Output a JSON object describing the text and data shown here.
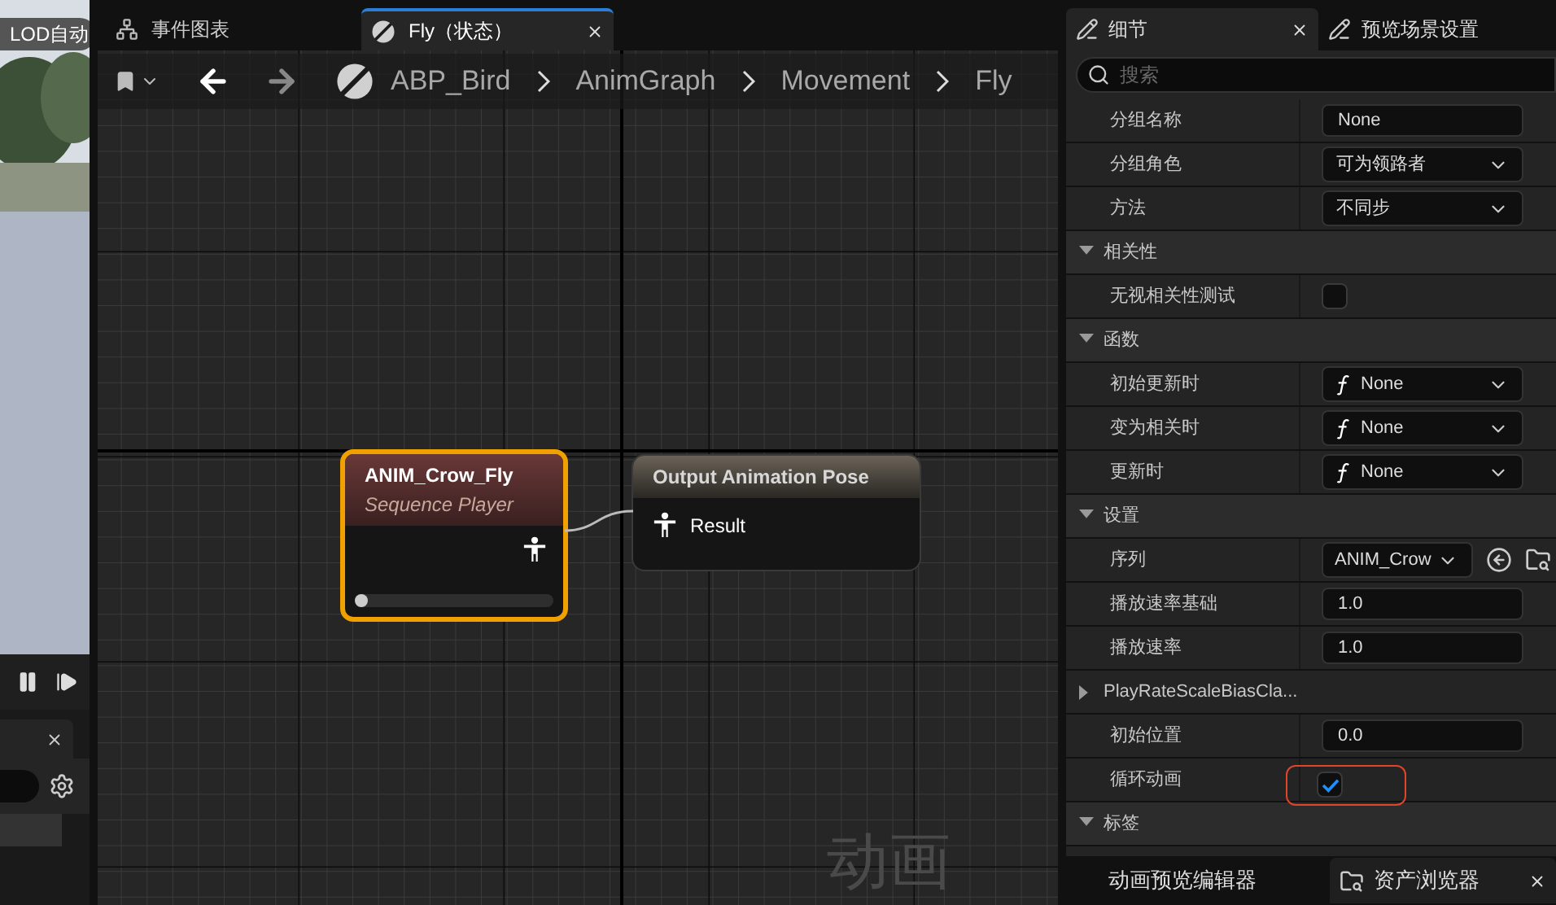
{
  "viewport": {
    "lod_badge": "LOD自动",
    "controls": [
      {
        "kind": "pause"
      },
      {
        "kind": "step"
      }
    ]
  },
  "graph_tabs": [
    {
      "label": "事件图表",
      "selected": false,
      "closable": false
    },
    {
      "label": "Fly（状态）",
      "selected": true,
      "closable": true
    }
  ],
  "breadcrumb": [
    "ABP_Bird",
    "AnimGraph",
    "Movement",
    "Fly"
  ],
  "nodes": [
    {
      "kind": "sequence",
      "title": "ANIM_Crow_Fly",
      "subtitle": "Sequence Player",
      "selected": true,
      "level": 0
    },
    {
      "kind": "output",
      "title": "Output Animation Pose",
      "pin": "Result",
      "selected": false
    }
  ],
  "graph_watermark": "动画",
  "details_tabs": [
    {
      "label": "细节",
      "selected": true,
      "closable": true
    },
    {
      "label": "预览场景设置",
      "selected": false,
      "closable": false
    }
  ],
  "search": {
    "placeholder": "搜索"
  },
  "rows": [
    {
      "kind": "text",
      "label": "分组名称",
      "value": "None"
    },
    {
      "kind": "dropdown",
      "label": "分组角色",
      "value": "可为领路者"
    },
    {
      "kind": "dropdown",
      "label": "方法",
      "value": "不同步"
    },
    {
      "kind": "section",
      "label": "相关性",
      "expanded": true
    },
    {
      "kind": "checkbox",
      "label": "无视相关性测试",
      "checked": false,
      "highlighted": false
    },
    {
      "kind": "section",
      "label": "函数",
      "expanded": true
    },
    {
      "kind": "function",
      "label": "初始更新时",
      "value": "None"
    },
    {
      "kind": "function",
      "label": "变为相关时",
      "value": "None"
    },
    {
      "kind": "function",
      "label": "更新时",
      "value": "None"
    },
    {
      "kind": "section",
      "label": "设置",
      "expanded": true
    },
    {
      "kind": "asset",
      "label": "序列",
      "value": "ANIM_Crow"
    },
    {
      "kind": "text",
      "label": "播放速率基础",
      "value": "1.0"
    },
    {
      "kind": "text",
      "label": "播放速率",
      "value": "1.0"
    },
    {
      "kind": "group",
      "label": "PlayRateScaleBiasCla...",
      "expanded": false
    },
    {
      "kind": "text",
      "label": "初始位置",
      "value": "0.0"
    },
    {
      "kind": "checkbox",
      "label": "循环动画",
      "checked": true,
      "highlighted": true
    },
    {
      "kind": "section",
      "label": "标签",
      "expanded": true
    }
  ],
  "bottom_tabs": [
    {
      "label": "动画预览编辑器",
      "icon": false,
      "selected": false,
      "closable": false
    },
    {
      "label": "资产浏览器",
      "icon": true,
      "selected": true,
      "closable": true
    }
  ]
}
